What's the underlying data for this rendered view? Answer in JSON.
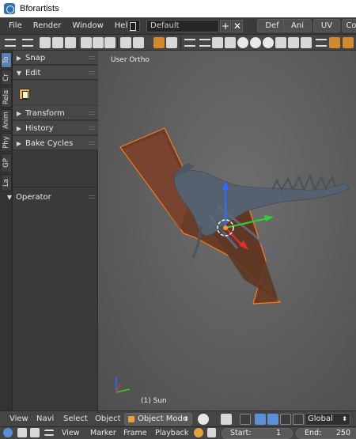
{
  "window": {
    "title": "Bforartists"
  },
  "menubar": {
    "items": [
      "File",
      "Render",
      "Window",
      "Help"
    ],
    "screen_layout": "Default",
    "add_symbol": "+",
    "remove_symbol": "✕",
    "workspace_tabs": [
      "Def",
      "Ani",
      "UV",
      "Co"
    ]
  },
  "toolbar": {
    "icons": [
      "menu-icon",
      "new-file-icon",
      "open-file-icon",
      "save-icon",
      "import-icon",
      "render-icon",
      "object-icon",
      "snap-icon",
      "view-icon",
      "shading-icon",
      "layer-icon",
      "frame-icon"
    ]
  },
  "left_tabs": [
    "To",
    "Cr",
    "Rela",
    "Anim",
    "Phy",
    "GP",
    "La"
  ],
  "toolshelf": {
    "panels": [
      {
        "label": "Snap",
        "expanded": false
      },
      {
        "label": "Edit",
        "expanded": true
      },
      {
        "label": "Transform",
        "expanded": false
      },
      {
        "label": "History",
        "expanded": false
      },
      {
        "label": "Bake Cycles",
        "expanded": false
      }
    ],
    "operator_label": "Operator",
    "collapsed_symbol": "▶",
    "expanded_symbol": "▼"
  },
  "viewport": {
    "view_label": "User Ortho",
    "object_label": "(1) Sun",
    "colors": {
      "selection_outline": "#ff7a1a",
      "x_axis": "#e03030",
      "y_axis": "#30d030",
      "z_axis": "#2f6bff"
    }
  },
  "viewport_header": {
    "menus": [
      "View",
      "Navi",
      "Select",
      "Object"
    ],
    "mode": "Object Mode",
    "orientation": "Global",
    "dropdown_arrow": "⬍"
  },
  "timeline": {
    "menus": [
      "View",
      "Marker",
      "Frame",
      "Playback"
    ],
    "start_label": "Start:",
    "start_value": "1",
    "end_label": "End:",
    "end_value": "250"
  }
}
